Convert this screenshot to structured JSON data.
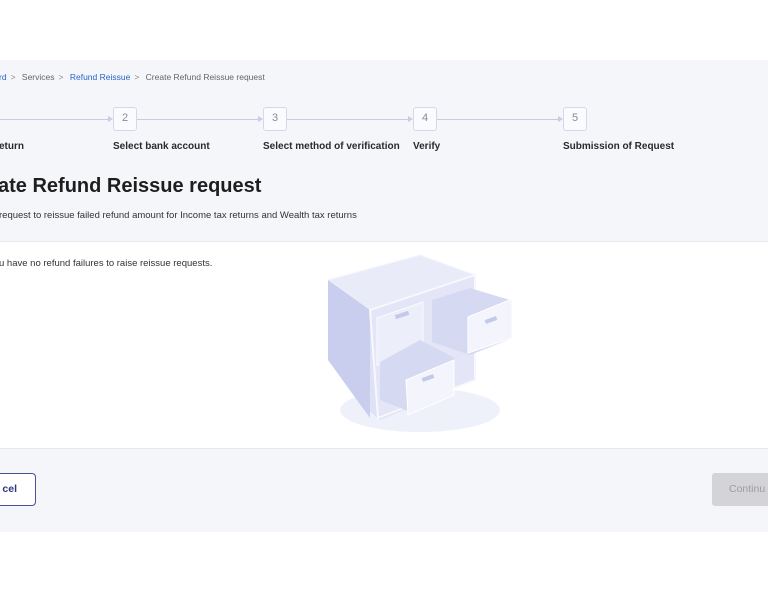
{
  "breadcrumb": [
    {
      "label": "rd",
      "link": true
    },
    {
      "label": "Services",
      "link": false
    },
    {
      "label": "Refund Reissue",
      "link": true
    },
    {
      "label": "Create Refund Reissue request",
      "link": false
    }
  ],
  "breadcrumb_separator": ">",
  "steps": [
    {
      "number": "",
      "label": "eturn"
    },
    {
      "number": "2",
      "label": "Select bank account"
    },
    {
      "number": "3",
      "label": "Select method of verification"
    },
    {
      "number": "4",
      "label": "Verify"
    },
    {
      "number": "5",
      "label": "Submission of Request"
    }
  ],
  "page": {
    "title": "ate Refund Reissue request",
    "subtitle": "request to reissue failed refund amount for Income tax returns and Wealth tax returns",
    "empty_message": "u have no refund failures to raise reissue requests."
  },
  "footer": {
    "cancel_label": "cel",
    "continue_label": "Continu"
  },
  "colors": {
    "panel": "#f5f6fa",
    "link": "#2a63c9",
    "primary": "#2f3580",
    "disabled": "#d4d4d8"
  }
}
